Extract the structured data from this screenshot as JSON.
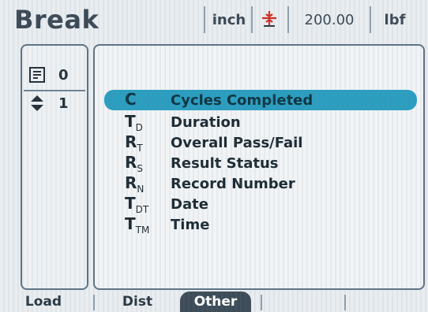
{
  "header": {
    "title": "Break",
    "units": "inch",
    "value": "200.00",
    "force_unit": "lbf",
    "icons": {
      "direction": "arrows-converge-icon"
    }
  },
  "left_panel": {
    "rows": [
      {
        "icon": "list-icon",
        "value": "0"
      },
      {
        "icon": "up-down-arrow-icon",
        "value": "1"
      }
    ]
  },
  "main": {
    "items": [
      {
        "symbol": "C",
        "sub": "",
        "label": "Cycles Completed",
        "selected": true
      },
      {
        "symbol": "T",
        "sub": "D",
        "label": "Duration"
      },
      {
        "symbol": "R",
        "sub": "T",
        "label": "Overall Pass/Fail"
      },
      {
        "symbol": "R",
        "sub": "S",
        "label": "Result Status"
      },
      {
        "symbol": "R",
        "sub": "N",
        "label": "Record Number"
      },
      {
        "symbol": "T",
        "sub": "DT",
        "label": "Date"
      },
      {
        "symbol": "T",
        "sub": "TM",
        "label": "Time"
      }
    ]
  },
  "tabs": {
    "load": "Load",
    "dist": "Dist",
    "other": "Other",
    "active": "Other"
  },
  "colors": {
    "accent": "#2b9ec0",
    "tab_active_bg": "#3d4c57",
    "arrow_red": "#d12a1f"
  }
}
